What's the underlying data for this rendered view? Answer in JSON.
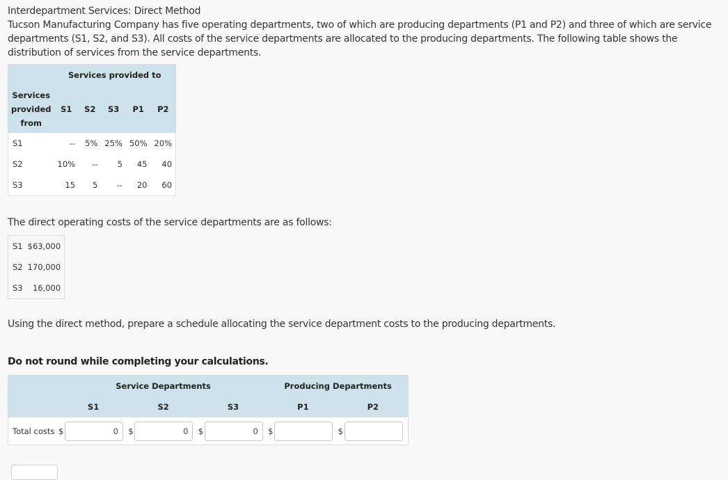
{
  "title": "Interdepartment Services: Direct Method",
  "intro": "Tucson Manufacturing Company has five operating departments, two of which are producing departments (P1 and P2) and three of which are service departments (S1, S2, and S3). All costs of the service departments are allocated to the producing departments. The following table shows the distribution of services from the service departments.",
  "distribution_table": {
    "top_header": "Services provided to",
    "row_header_lines": [
      "Services",
      "provided",
      "from"
    ],
    "columns": [
      "S1",
      "S2",
      "S3",
      "P1",
      "P2"
    ],
    "rows": [
      {
        "label": "S1",
        "values": [
          "--",
          "5%",
          "25%",
          "50%",
          "20%"
        ]
      },
      {
        "label": "S2",
        "values": [
          "10%",
          "--",
          "5",
          "45",
          "40"
        ]
      },
      {
        "label": "S3",
        "values": [
          "15",
          "5",
          "--",
          "20",
          "60"
        ]
      }
    ]
  },
  "costs_intro": "The direct operating costs of the service departments are as follows:",
  "costs_table": [
    {
      "label": "S1",
      "value": "$63,000"
    },
    {
      "label": "S2",
      "value": "170,000"
    },
    {
      "label": "S3",
      "value": "16,000"
    }
  ],
  "instruction": "Using the direct method, prepare a schedule allocating the service department costs to the producing departments.",
  "note": "Do not round while completing your calculations.",
  "answer_table": {
    "group_service": "Service Departments",
    "group_producing": "Producing Departments",
    "columns": [
      "S1",
      "S2",
      "S3",
      "P1",
      "P2"
    ],
    "row_label": "Total costs",
    "currency": "$",
    "values": [
      "0",
      "0",
      "0",
      "",
      ""
    ]
  },
  "colors": {
    "header_bg": "#cde2ea",
    "page_bg": "#f9f9f9"
  }
}
